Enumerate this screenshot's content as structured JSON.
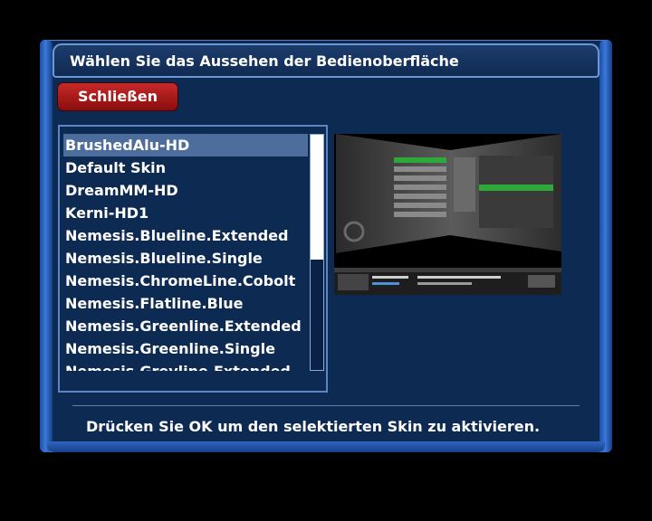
{
  "window": {
    "title": "Wählen Sie das Aussehen der Bedienoberfläche"
  },
  "close_button": {
    "label": "Schließen"
  },
  "skin_list": {
    "items": [
      {
        "label": "BrushedAlu-HD",
        "selected": true
      },
      {
        "label": "Default Skin"
      },
      {
        "label": "DreamMM-HD"
      },
      {
        "label": "Kerni-HD1"
      },
      {
        "label": "Nemesis.Blueline.Extended"
      },
      {
        "label": "Nemesis.Blueline.Single"
      },
      {
        "label": "Nemesis.ChromeLine.Cobolt"
      },
      {
        "label": "Nemesis.Flatline.Blue"
      },
      {
        "label": "Nemesis.Greenline.Extended"
      },
      {
        "label": "Nemesis.Greenline.Single"
      },
      {
        "label": "Nemesis.Greyline.Extended"
      }
    ],
    "scroll_fraction": 0.53
  },
  "hint": "Drücken Sie OK um den selektierten Skin zu aktivieren.",
  "colors": {
    "panel": "#0d2a52",
    "frame": "#2f66c2",
    "close_button": "#b01b1b",
    "selection": "#4d6d9c",
    "preview_highlight": "#2ea838"
  }
}
